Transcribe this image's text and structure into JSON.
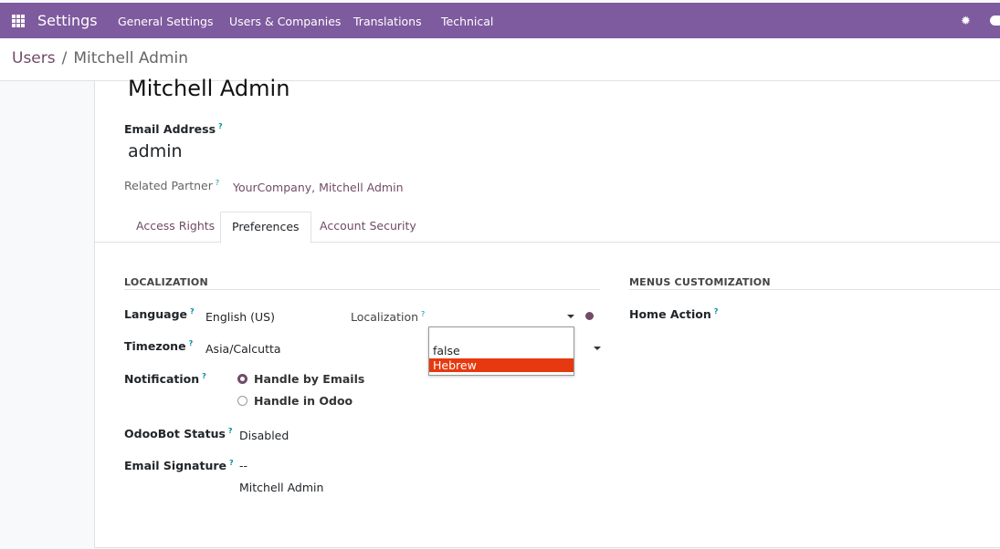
{
  "topbar": {
    "app_title": "Settings",
    "menu": [
      "General Settings",
      "Users & Companies",
      "Translations",
      "Technical"
    ],
    "bug_icon": "bug-icon",
    "chat_icon": "chat-icon"
  },
  "breadcrumb": {
    "parent": "Users",
    "separator": "/",
    "current": "Mitchell Admin"
  },
  "user": {
    "name": "Mitchell Admin",
    "email_label": "Email Address",
    "email": "admin",
    "related_partner_label": "Related Partner",
    "related_partner": "YourCompany, Mitchell Admin"
  },
  "tabs": [
    "Access Rights",
    "Preferences",
    "Account Security"
  ],
  "active_tab": "Preferences",
  "localization": {
    "title": "LOCALIZATION",
    "language_label": "Language",
    "language": "English (US)",
    "localization_label": "Localization",
    "timezone_label": "Timezone",
    "timezone": "Asia/Calcutta",
    "notification_label": "Notification",
    "notification_options": [
      "Handle by Emails",
      "Handle in Odoo"
    ],
    "notification_selected": "Handle by Emails",
    "odoobot_label": "OdooBot Status",
    "odoobot": "Disabled",
    "signature_label": "Email Signature",
    "signature_line1": "--",
    "signature_line2": "Mitchell Admin"
  },
  "menus": {
    "title": "MENUS CUSTOMIZATION",
    "home_action_label": "Home Action"
  },
  "dropdown": {
    "options": [
      "",
      "false",
      "Hebrew"
    ],
    "highlighted": "Hebrew"
  },
  "help_mark": "?",
  "colors": {
    "brand": "#7e5a9e",
    "accent": "#714b67",
    "highlight": "#e6390f"
  }
}
